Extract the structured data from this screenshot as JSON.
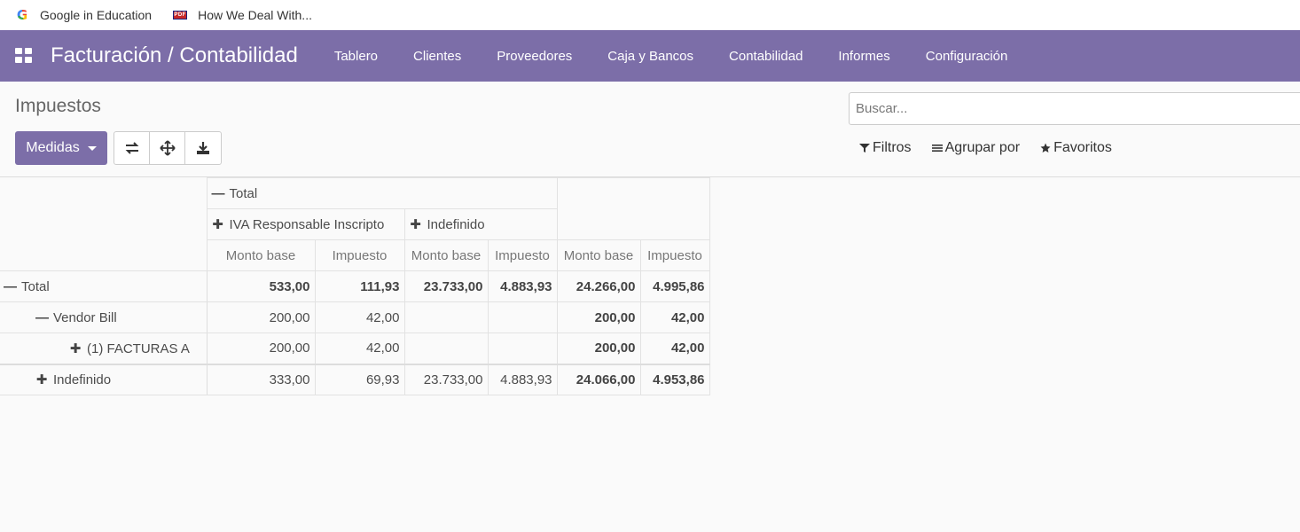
{
  "bookmarks": [
    {
      "label": "Google in Education",
      "icon": "google-icon"
    },
    {
      "label": "How We Deal With...",
      "icon": "pdf-icon",
      "icon_text": "PDF"
    }
  ],
  "navbar": {
    "brand": "Facturación / Contabilidad",
    "menu": [
      "Tablero",
      "Clientes",
      "Proveedores",
      "Caja y Bancos",
      "Contabilidad",
      "Informes",
      "Configuración"
    ],
    "color": "#7c6ea8"
  },
  "control": {
    "breadcrumb": "Impuestos",
    "measures_label": "Medidas",
    "search_placeholder": "Buscar...",
    "filters_label": "Filtros",
    "group_by_label": "Agrupar por",
    "favorites_label": "Favoritos"
  },
  "pivot": {
    "col_total": "Total",
    "col_groups": [
      "IVA Responsable Inscripto",
      "Indefinido"
    ],
    "measures": [
      "Monto base",
      "Impuesto",
      "Monto base",
      "Impuesto",
      "Monto base",
      "Impuesto"
    ],
    "rows": [
      {
        "label": "Total",
        "values": [
          "533,00",
          "111,93",
          "23.733,00",
          "4.883,93",
          "24.266,00",
          "4.995,86"
        ]
      },
      {
        "label": "Vendor Bill",
        "values": [
          "200,00",
          "42,00",
          "",
          "",
          "200,00",
          "42,00"
        ]
      },
      {
        "label": "(1) FACTURAS A",
        "values": [
          "200,00",
          "42,00",
          "",
          "",
          "200,00",
          "42,00"
        ]
      },
      {
        "label": "Indefinido",
        "values": [
          "333,00",
          "69,93",
          "23.733,00",
          "4.883,93",
          "24.066,00",
          "4.953,86"
        ]
      }
    ]
  }
}
